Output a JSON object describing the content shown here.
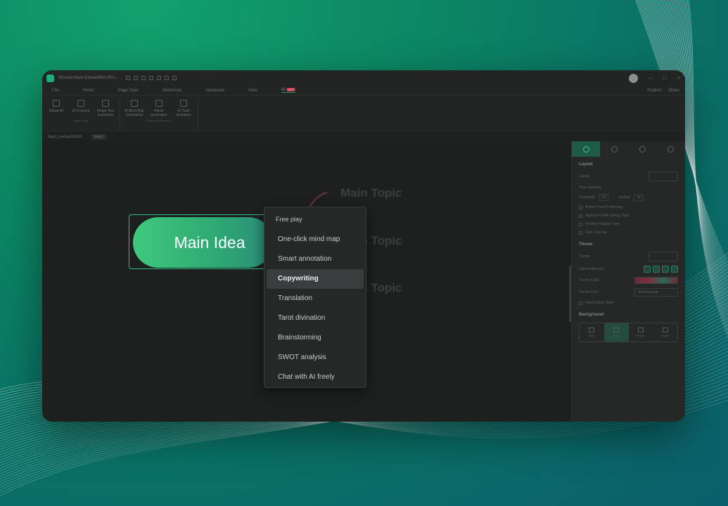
{
  "app": {
    "title": "Wondershare EdrawMind (Pro...",
    "menu_tabs": [
      "File",
      "Home",
      "Page Style",
      "Slideshow",
      "Advanced",
      "View",
      "AI"
    ],
    "active_menu_tab": "AI",
    "hot_badge": "HOT",
    "menu_right": [
      "Publish",
      "Share"
    ]
  },
  "ribbon": {
    "groups": [
      {
        "label": "Smart Tools",
        "items": [
          "Edraw AI",
          "AI Drawing",
          "Image Text Extraction"
        ]
      },
      {
        "label": "Notion AI Features",
        "items": [
          "AI Mind Map Generation",
          "Article generation",
          "AI Tarot divination"
        ]
      }
    ]
  },
  "docbar": {
    "tabs": [
      "Map1_backup161036",
      "Map1"
    ]
  },
  "canvas": {
    "main_idea": "Main Idea",
    "topics": [
      "Main Topic",
      "Main Topic",
      "Main Topic"
    ]
  },
  "panel": {
    "layout_title": "Layout",
    "layout_label": "Layout",
    "topic_spacing": "Topic Spacing",
    "horizontal_label": "Horizontal",
    "horizontal_value": "30",
    "vertical_label": "Vertical",
    "vertical_value": "30",
    "checks": [
      "Branch Free Positioning",
      "Alignment With Sibling Topic",
      "Flexible Floating Topic",
      "Topic Overlap"
    ],
    "theme_title": "Theme",
    "theme_label": "Theme",
    "colored_branch": "Colored Branch",
    "theme_color": "Theme Color",
    "theme_font": "Theme Font",
    "theme_font_value": "Arial Regular",
    "hand_drawn": "Hand Drawn Style",
    "background_title": "Background",
    "bg_tiles": [
      "None",
      "Color",
      "Texture",
      "Image"
    ],
    "active_bg": "Color"
  },
  "dropdown": {
    "header": "Free play",
    "items": [
      "One-click mind map",
      "Smart annotation",
      "Copywriting",
      "Translation",
      "Tarot divination",
      "Brainstorming",
      "SWOT analysis",
      "Chat with AI freely"
    ],
    "selected": "Copywriting"
  }
}
